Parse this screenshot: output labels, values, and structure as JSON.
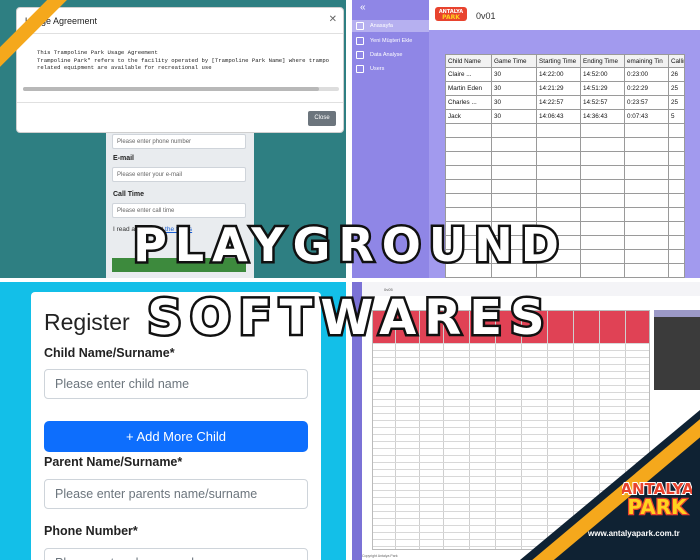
{
  "headline": {
    "line1": "PLAYGROUND",
    "line2": "SOFTWARES"
  },
  "brand": {
    "logo_text_top": "ANTALYA",
    "logo_text_bottom": "PARK",
    "url": "www.antalyapark.com.tr",
    "colors": {
      "orange": "#f5a81c",
      "dark_navy": "#0f2233"
    }
  },
  "agreement_panel": {
    "dialog_title": "Usage Agreement",
    "body_lines": [
      "This Trampoline Park Usage Agreement",
      "Trampoline Park\" refers to the facility operated by [Trampoline Park Name] where trampo",
      "related equipment are available for recreational use"
    ],
    "close_button": "Close",
    "background_form": {
      "phone_placeholder": "Please enter phone number",
      "email_label": "E-mail",
      "email_placeholder": "Please enter your e-mail",
      "call_time_label": "Call Time",
      "call_time_placeholder": "Please enter call time",
      "terms_prefix": "I read and accept",
      "terms_link": "the terms"
    },
    "colors": {
      "background": "#2e7f82"
    }
  },
  "tracking_app": {
    "title": "0v01",
    "logo_text": "ANTALYA PARK",
    "sidebar_items": [
      "Anasayfa",
      "Yeni Müşteri Ekle",
      "Data Analyse",
      "Users"
    ],
    "table": {
      "columns": [
        "Child Name",
        "Game Time",
        "Starting Time",
        "Ending Time",
        "emaining Tin",
        "Callin"
      ],
      "rows": [
        [
          "Claire ...",
          "30",
          "14:22:00",
          "14:52:00",
          "0:23:00",
          "26"
        ],
        [
          "Martin Eden",
          "30",
          "14:21:29",
          "14:51:29",
          "0:22:29",
          "25"
        ],
        [
          "Charles ...",
          "30",
          "14:22:57",
          "14:52:57",
          "0:23:57",
          "25"
        ],
        [
          "Jack",
          "30",
          "14:06:43",
          "14:36:43",
          "0:07:43",
          "5"
        ]
      ],
      "empty_rows": 11
    },
    "colors": {
      "sidebar": "#8f86e6",
      "content": "#a29aee"
    }
  },
  "register_panel": {
    "title": "Register",
    "child_label": "Child Name/Surname*",
    "child_placeholder": "Please enter child name",
    "add_child_button": "+ Add More Child",
    "parent_label": "Parent Name/Surname*",
    "parent_placeholder": "Please enter parents name/surname",
    "phone_label": "Phone Number*",
    "phone_placeholder": "Please enter phone number",
    "colors": {
      "background": "#13bfe8",
      "button": "#0d6efd"
    }
  },
  "grid_app": {
    "title": "0v05",
    "footer": "Copyright Antalya Park",
    "colors": {
      "header": "#e04255",
      "strip": "#7b72d6"
    }
  }
}
